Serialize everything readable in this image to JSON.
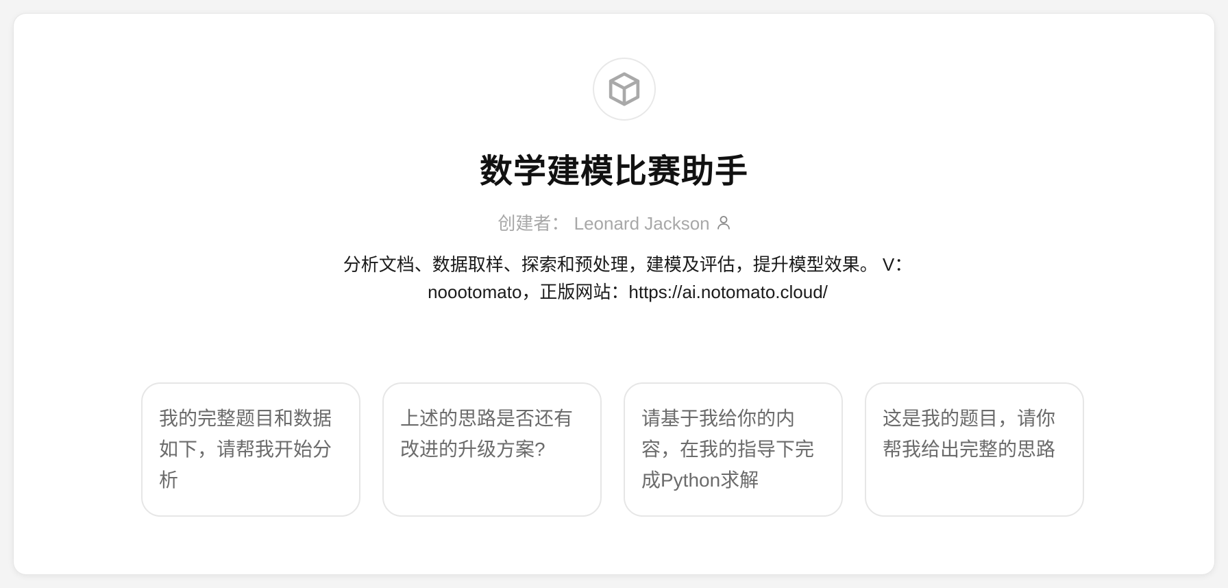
{
  "gpt": {
    "avatar_icon": "cube-icon",
    "title": "数学建模比赛助手",
    "creator_prefix": "创建者：",
    "creator_name": "Leonard Jackson",
    "creator_icon": "person-icon",
    "description_line1": "分析文档、数据取样、探索和预处理，建模及评估，提升模型效果。 V：",
    "description_line2": "noootomato，正版网站：https://ai.notomato.cloud/"
  },
  "starters": [
    {
      "label": "我的完整题目和数据如下，请帮我开始分析"
    },
    {
      "label": "上述的思路是否还有改进的升级方案?"
    },
    {
      "label": "请基于我给你的内容，在我的指导下完成Python求解"
    },
    {
      "label": "这是我的题目，请你帮我给出完整的思路"
    }
  ],
  "colors": {
    "title": "#111111",
    "muted": "#a8a8a8",
    "card_text": "#6b6b6b",
    "border": "#e6e6e6"
  }
}
